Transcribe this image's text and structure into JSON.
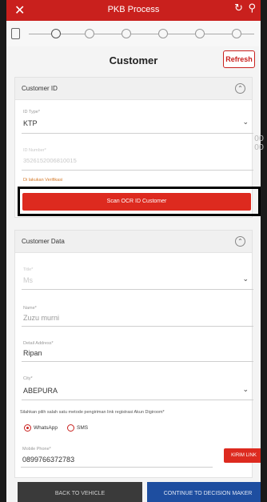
{
  "app": {
    "title": "PKB Process",
    "close_icon": "close-icon",
    "refresh_label": "Refresh"
  },
  "page": {
    "title": "Customer"
  },
  "customer_id": {
    "section_title": "Customer ID",
    "id_type_label": "ID Type*",
    "id_type_value": "KTP",
    "id_number_label": "ID Number*",
    "id_number_value": "3526152006810015",
    "warning": "Di lakukan Verifikasi",
    "scan_button": "Scan OCR ID Customer"
  },
  "customer_data": {
    "section_title": "Customer Data",
    "title_label": "Title*",
    "title_value": "Ms",
    "name_label": "Name*",
    "name_value": "Zuzu murni",
    "detail_address_label": "Detail Address*",
    "detail_address_value": "Ripan",
    "city_label": "City*",
    "city_value": "ABEPURA",
    "method_note": "Silahkan pilih salah satu metode pengiriman link registrasi Akun Digiroom*",
    "radio_whatsapp": "WhatsApp",
    "radio_sms": "SMS",
    "mobile_label": "Mobile Phone*",
    "mobile_value": "0899766372783",
    "send_link": "KIRIM LINK"
  },
  "footer": {
    "back": "BACK TO VEHICLE",
    "continue": "CONTINUE TO DECISION MAKER"
  }
}
